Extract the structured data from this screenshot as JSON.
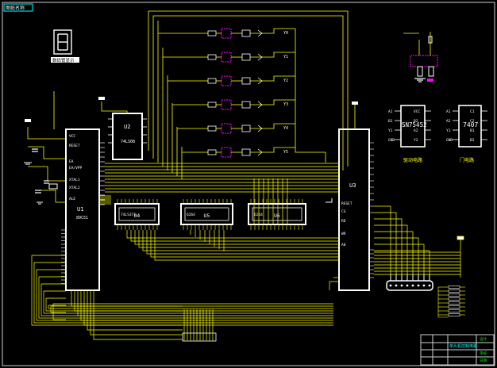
{
  "window": {
    "tab_label": "图纸名称"
  },
  "chips": {
    "u1": {
      "ref": "U1",
      "part": "89C51"
    },
    "u2": {
      "ref": "U2",
      "part": "74LS08"
    },
    "u3": {
      "ref": "U3"
    },
    "u4": {
      "ref": "U4",
      "part": "74LS373"
    },
    "u5": {
      "ref": "U5",
      "part": "6264"
    },
    "u6": {
      "ref": "U6",
      "part": "6264"
    },
    "ic_left": {
      "part": "SN75452",
      "pins_left": [
        "A1",
        "B1",
        "Y1",
        "GND"
      ],
      "pins_right": [
        "VCC",
        "B2",
        "A2",
        "Y2"
      ]
    },
    "ic_right": {
      "part": "7407",
      "pins_left": [
        "A1",
        "A2",
        "Y1",
        "GND"
      ],
      "pins_right": [
        "C1",
        "C2",
        "B1",
        "B2"
      ]
    }
  },
  "u1_pins": [
    "VCC",
    "RESET",
    "EA",
    "EA/VPP",
    "XTAL1",
    "XTAL2",
    "ALE"
  ],
  "u3_pins": [
    "RESET",
    "CS",
    "RD",
    "WR",
    "A0"
  ],
  "outputs": [
    "Y0",
    "Y1",
    "Y2",
    "Y3",
    "Y4",
    "Y5"
  ],
  "legends": {
    "ic_left_caption": "驱动电路",
    "ic_right_caption": "门电路",
    "display_caption": "数码管显示"
  },
  "title_block": {
    "title": "单片机控制电路",
    "rows": [
      "设计",
      "审核",
      "日期"
    ]
  },
  "colors": {
    "wire": "#ffff00",
    "part": "#ffffff",
    "highlight": "#ff00ff",
    "frame": "#ffffff",
    "title": "#00ffff",
    "net": "#00ff00"
  }
}
